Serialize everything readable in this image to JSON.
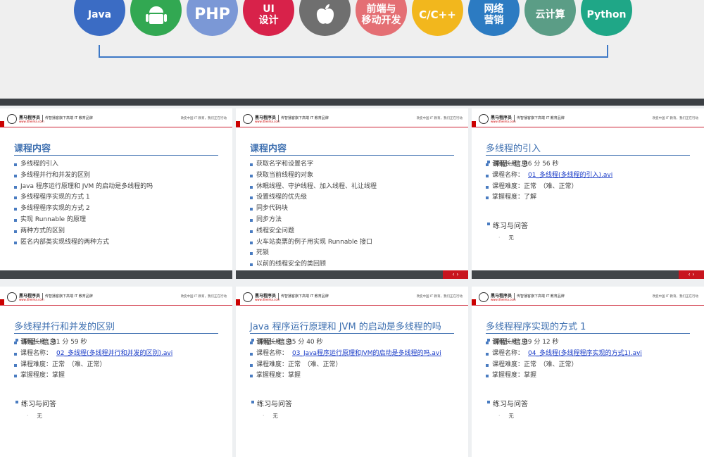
{
  "banner": {
    "circles": [
      {
        "label": "Java",
        "color": "#3b6cc4"
      },
      {
        "label": "",
        "color": "#32a852"
      },
      {
        "label": "PHP",
        "color": "#7b98d6"
      },
      {
        "label": "UI\n设计",
        "color": "#d8224a"
      },
      {
        "label": "",
        "color": "#6f6f6f"
      },
      {
        "label": "前端与\n移动开发",
        "color": "#e46f74"
      },
      {
        "label": "C/C++",
        "color": "#f2b71d"
      },
      {
        "label": "网络\n营销",
        "color": "#2c7bc2"
      },
      {
        "label": "云计算",
        "color": "#5b9d86"
      },
      {
        "label": "Python",
        "color": "#1fa787"
      }
    ]
  },
  "slide_common": {
    "logo_text": "黑马程序员",
    "logo_sub": "www.itheima.com",
    "slogan": "传智播客旗下高端 IT 教育品牌",
    "right_text": "改变中国 IT 教育，我们正在行动",
    "nav": "‹  ›"
  },
  "slides": [
    {
      "title": "课程内容",
      "items": [
        "多线程的引入",
        "多线程并行和并发的区别",
        "Java 程序运行原理和 JVM 的启动是多线程的吗",
        "多线程程序实现的方式 1",
        "多线程程序实现的方式 2",
        "实现 Runnable 的原理",
        "两种方式的区别",
        "匿名内部类实现线程的两种方式"
      ]
    },
    {
      "title": "课程内容",
      "items": [
        "获取名字和设置名字",
        "获取当前线程的对象",
        "休眠线程、守护线程、加入线程、礼让线程",
        "设置线程的优先级",
        "同步代码块",
        "同步方法",
        "线程安全问题",
        "火车站卖票的例子用实现 Runnable 接口",
        "死锁",
        "以前的线程安全的类回顾"
      ]
    },
    {
      "title": "多线程的引入",
      "section1": "课程一信息",
      "duration_label": "课程长度：",
      "duration": "06 分 56 秒",
      "name_label": "课程名称：",
      "name": "01_多线程(多线程的引入).avi",
      "difficulty_label": "课程难度：",
      "difficulty": "正常　（难、正常）",
      "mastery_label": "掌握程度：",
      "mastery": "了解",
      "section2": "练习与问答",
      "answer": "无"
    },
    {
      "title": "多线程并行和并发的区别",
      "section1": "课程一信息",
      "duration_label": "课程长度：",
      "duration": "01 分 59 秒",
      "name_label": "课程名称：",
      "name": "02_多线程(多线程并行和并发的区别).avi",
      "difficulty_label": "课程难度：",
      "difficulty": "正常　（难、正常）",
      "mastery_label": "掌握程度：",
      "mastery": "掌握",
      "section2": "练习与问答",
      "answer": "无"
    },
    {
      "title": "Java 程序运行原理和 JVM 的启动是多线程的吗",
      "section1": "课程一信息",
      "duration_label": "课程长度：",
      "duration": "05 分 40 秒",
      "name_label": "课程名称：",
      "name": "03_Java程序运行原理和JVM的启动是多线程的吗.avi",
      "difficulty_label": "课程难度：",
      "difficulty": "正常　（难、正常）",
      "mastery_label": "掌握程度：",
      "mastery": "掌握",
      "section2": "练习与问答",
      "answer": "无"
    },
    {
      "title": "多线程程序实现的方式 1",
      "section1": "课程一信息",
      "duration_label": "课程长度：",
      "duration": "09 分 12 秒",
      "name_label": "课程名称：",
      "name": "04_多线程(多线程程序实现的方式1).avi",
      "difficulty_label": "课程难度：",
      "difficulty": "正常　（难、正常）",
      "mastery_label": "掌握程度：",
      "mastery": "掌握",
      "section2": "练习与问答",
      "answer": "无"
    }
  ]
}
